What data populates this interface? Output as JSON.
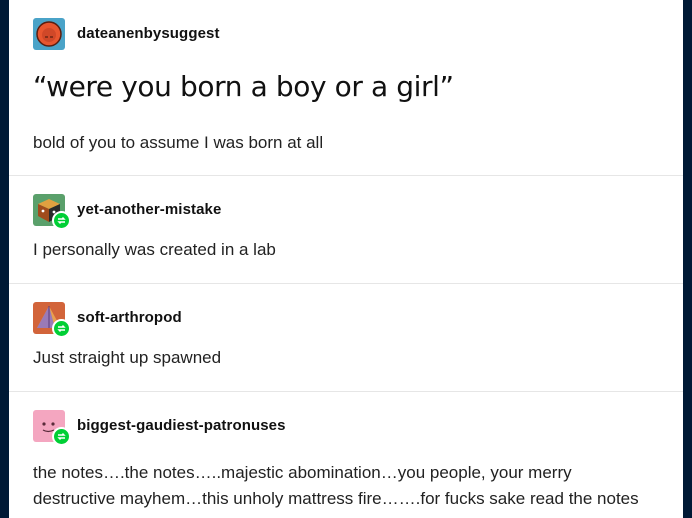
{
  "posts": [
    {
      "username": "dateanenbysuggest",
      "avatar_icon": "orange-face-avatar-icon",
      "title": "“were you born a boy or a girl”",
      "text": "bold of you to assume I was born at all"
    },
    {
      "username": "yet-another-mistake",
      "avatar_icon": "dice-avatar-icon",
      "reblog_icon": "reblog-icon",
      "text": "I personally was created in a lab"
    },
    {
      "username": "soft-arthropod",
      "avatar_icon": "pyramid-avatar-icon",
      "reblog_icon": "reblog-icon",
      "text": "Just straight up spawned"
    },
    {
      "username": "biggest-gaudiest-patronuses",
      "avatar_icon": "pink-face-avatar-icon",
      "reblog_icon": "reblog-icon",
      "text_line1": "the notes….the notes…..majestic abomination…you people, your merry",
      "text_line2": "destructive mayhem…this unholy mattress fire…….for fucks sake read the notes"
    }
  ],
  "colors": {
    "background": "#001935",
    "card": "#ffffff",
    "reblog_badge": "#00cf35"
  }
}
